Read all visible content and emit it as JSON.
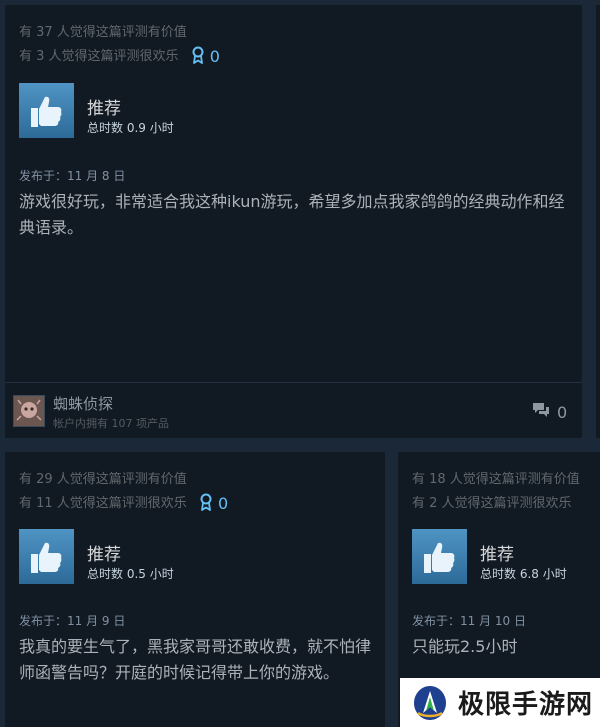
{
  "reviews": [
    {
      "votes_helpful": "有 37 人觉得这篇评测有价值",
      "votes_funny": "有 3 人觉得这篇评测很欢乐",
      "award_count": "0",
      "recommendation": "推荐",
      "hours": "总时数 0.9 小时",
      "posted": "发布于：11 月 8 日",
      "text": "游戏很好玩，非常适合我这种ikun游玩，希望多加点我家鸽鸽的经典动作和经典语录。",
      "author_name": "蜘蛛侦探",
      "author_games": "帐户内拥有 107 项产品",
      "comment_count": "0"
    },
    {
      "votes_helpful": "有 29 人觉得这篇评测有价值",
      "votes_funny": "有 11 人觉得这篇评测很欢乐",
      "award_count": "0",
      "recommendation": "推荐",
      "hours": "总时数 0.5 小时",
      "posted": "发布于：11 月 9 日",
      "text": "我真的要生气了，黑我家哥哥还敢收费，就不怕律师函警告吗？开庭的时候记得带上你的游戏。"
    },
    {
      "votes_helpful": "有 18 人觉得这篇评测有价值",
      "votes_funny": "有 2 人觉得这篇评测很欢乐",
      "recommendation": "推荐",
      "hours": "总时数 6.8 小时",
      "posted": "发布于：11 月 10 日",
      "text": "只能玩2.5小时"
    }
  ],
  "watermark": {
    "text": "极限手游网"
  },
  "colors": {
    "page_bg": "#1b2838",
    "card_bg": "#111923",
    "thumb_blue": "#4f94c4",
    "award_blue": "#66c0f4"
  },
  "icons": {
    "thumb": "thumbs-up-icon",
    "award": "award-ribbon-icon",
    "comment": "comment-bubble-icon"
  }
}
